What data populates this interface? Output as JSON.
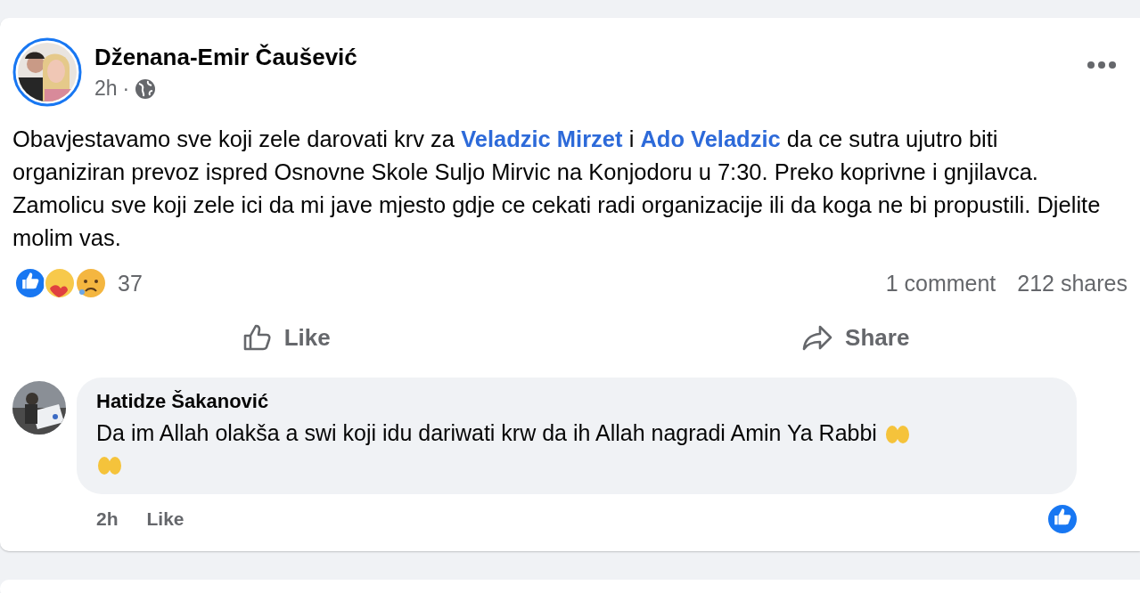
{
  "post": {
    "author": "Dženana-Emir Čaušević",
    "time": "2h",
    "time_separator": "·",
    "body": [
      {
        "kind": "text",
        "text": "Obavjestavamo sve koji zele darovati krv za "
      },
      {
        "kind": "link",
        "text": "Veladzic Mirzet"
      },
      {
        "kind": "text",
        "text": " i "
      },
      {
        "kind": "link",
        "text": "Ado Veladzic"
      },
      {
        "kind": "text",
        "text": " da ce sutra ujutro biti organiziran prevoz ispred Osnovne Skole Suljo Mirvic na Konjodoru u 7:30. Preko koprivne i gnjilavca. Zamolicu sve koji zele ici da mi jave mjesto gdje ce cekati radi organizacije ili da koga ne bi propustili. Djelite molim vas."
      }
    ],
    "reactions": {
      "count": "37",
      "comments": "1 comment",
      "shares": "212 shares"
    },
    "actions": [
      {
        "kind": "like",
        "label": "Like"
      },
      {
        "kind": "share",
        "label": "Share"
      }
    ],
    "comment": {
      "author": "Hatidze Šakanović",
      "text": "Da im Allah olakša a swi koji idu dariwati krw da ih Allah nagradi Amin Ya Rabbi",
      "time": "2h",
      "like_label": "Like"
    }
  }
}
